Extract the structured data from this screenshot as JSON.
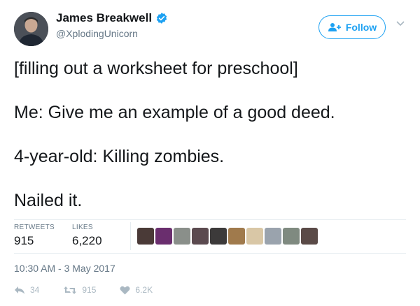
{
  "author": {
    "display_name": "James Breakwell",
    "handle": "@XplodingUnicorn",
    "avatar_icon": "avatar-photo",
    "verified_icon": "verified-badge-icon"
  },
  "follow_button": {
    "label": "Follow",
    "icon": "add-user-icon"
  },
  "menu_icon": "chevron-down-icon",
  "tweet": {
    "lines": [
      "[filling out a worksheet for preschool]",
      "Me: Give me an example of a good deed.",
      "4-year-old: Killing zombies.",
      "Nailed it."
    ]
  },
  "stats": {
    "retweets_label": "RETWEETS",
    "retweets_value": "915",
    "likes_label": "LIKES",
    "likes_value": "6,220"
  },
  "likers": [
    "#4a3a37",
    "#6a2e6e",
    "#8a8f8a",
    "#5b4a4f",
    "#3c3a3a",
    "#a07a4c",
    "#d9c7a6",
    "#9aa3ad",
    "#7f8a80",
    "#5a4a47"
  ],
  "timestamp": "10:30 AM - 3 May 2017",
  "actions": {
    "reply_count": "34",
    "retweet_count": "915",
    "like_count": "6.2K"
  },
  "colors": {
    "accent": "#1da1f2",
    "muted": "#657786",
    "icon_muted": "#aab8c2"
  }
}
